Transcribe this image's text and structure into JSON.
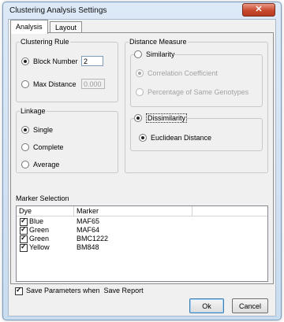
{
  "window": {
    "title": "Clustering Analysis Settings",
    "close_glyph": "✕"
  },
  "tabs": [
    {
      "label": "Analysis",
      "active": true
    },
    {
      "label": "Layout",
      "active": false
    }
  ],
  "clustering_rule": {
    "legend": "Clustering Rule",
    "block_number": {
      "label": "Block Number",
      "selected": true,
      "value": "2"
    },
    "max_distance": {
      "label": "Max Distance",
      "selected": false,
      "value": "0.000"
    }
  },
  "linkage": {
    "legend": "Linkage",
    "options": [
      {
        "label": "Single",
        "selected": true
      },
      {
        "label": "Complete",
        "selected": false
      },
      {
        "label": "Average",
        "selected": false
      }
    ]
  },
  "distance_measure": {
    "legend": "Distance Measure",
    "similarity": {
      "label": "Similarity",
      "selected": false,
      "options": [
        {
          "label": "Correlation Coefficient",
          "selected": true
        },
        {
          "label": "Percentage of Same Genotypes",
          "selected": false
        }
      ]
    },
    "dissimilarity": {
      "label": "Dissimilarity",
      "selected": true,
      "options": [
        {
          "label": "Euclidean Distance",
          "selected": true
        }
      ]
    }
  },
  "marker_selection": {
    "label": "Marker Selection",
    "columns": [
      "Dye",
      "Marker"
    ],
    "rows": [
      {
        "dye": "Blue",
        "marker": "MAF65",
        "checked": true
      },
      {
        "dye": "Green",
        "marker": "MAF64",
        "checked": true
      },
      {
        "dye": "Green",
        "marker": "BMC1222",
        "checked": true
      },
      {
        "dye": "Yellow",
        "marker": "BM848",
        "checked": true
      }
    ]
  },
  "save_params": {
    "label": "Save Parameters when  Save Report",
    "checked": true
  },
  "buttons": {
    "ok": "Ok",
    "cancel": "Cancel"
  }
}
